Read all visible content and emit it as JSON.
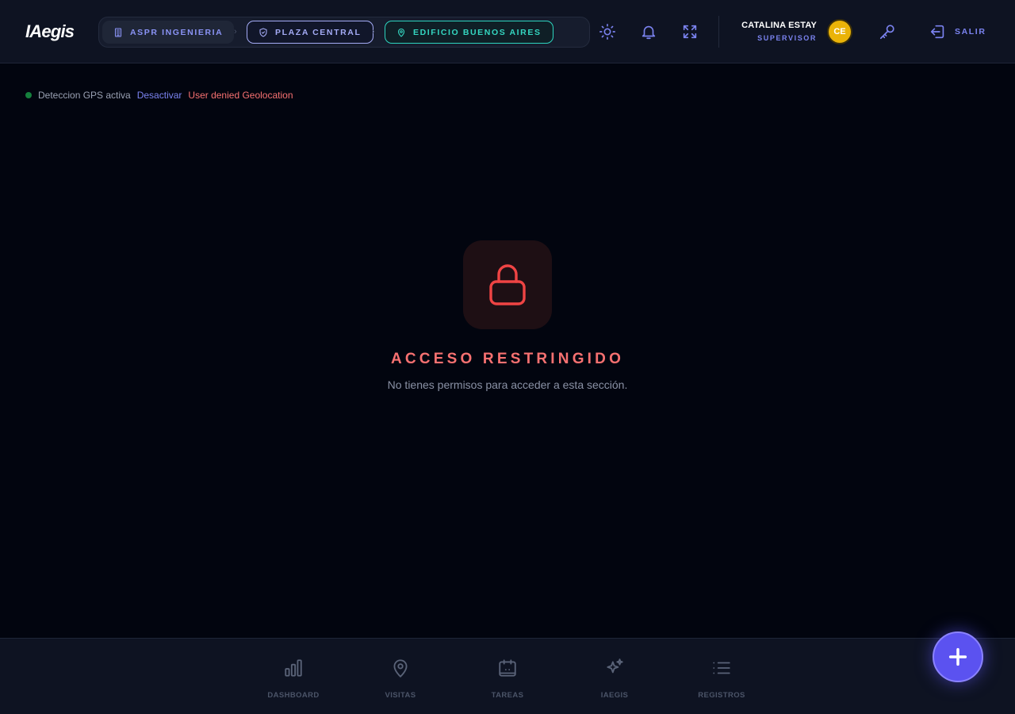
{
  "header": {
    "logo": "IAegis",
    "breadcrumbs": [
      {
        "label": "ASPR INGENIERIA",
        "icon": "building-icon"
      },
      {
        "label": "PLAZA CENTRAL",
        "icon": "shield-icon"
      },
      {
        "label": "EDIFICIO BUENOS AIRES",
        "icon": "map-pin-icon"
      }
    ],
    "actions": [
      "sun-icon",
      "bell-icon",
      "fullscreen-icon"
    ],
    "user": {
      "name": "CATALINA ESTAY",
      "role": "SUPERVISOR",
      "initials": "CE"
    },
    "key_icon": "key-icon",
    "logout_label": "SALIR"
  },
  "gps": {
    "status": "Deteccion GPS activa",
    "action": "Desactivar",
    "error": "User denied Geolocation"
  },
  "restricted": {
    "icon": "lock-icon",
    "title": "ACCESO RESTRINGIDO",
    "message": "No tienes permisos para acceder a esta sección."
  },
  "bottom_nav": {
    "items": [
      {
        "label": "DASHBOARD",
        "icon": "bar-chart-icon"
      },
      {
        "label": "VISITAS",
        "icon": "map-pin-icon"
      },
      {
        "label": "TAREAS",
        "icon": "calendar-icon"
      },
      {
        "label": "IAEGIS",
        "icon": "sparkles-icon"
      },
      {
        "label": "REGISTROS",
        "icon": "list-icon"
      }
    ]
  },
  "fab": {
    "icon": "plus-icon"
  },
  "colors": {
    "background": "#02050f",
    "panel": "#0e1322",
    "accent": "#7b83f0",
    "teal": "#2dd4bf",
    "danger": "#f87171",
    "avatar": "#eab308",
    "fab": "#5b52f0"
  }
}
